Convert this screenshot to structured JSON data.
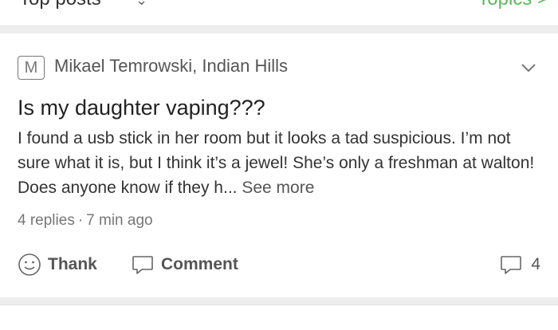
{
  "top_bar": {
    "left_label": "Top posts",
    "right_label": "Topics >"
  },
  "post": {
    "avatar_letter": "M",
    "author": "Mikael Temrowski, Indian Hills",
    "title": "Is my daughter vaping???",
    "body": "I found a usb stick in her room but it looks a tad suspicious. I’m not sure what it is, but I think it’s a jewel! She’s only a freshman at walton! Does anyone know if they h...",
    "see_more": "See more",
    "replies": "4 replies",
    "separator": "·",
    "time": "7 min ago",
    "thank_label": "Thank",
    "comment_label": "Comment",
    "comment_count": "4"
  },
  "next_post_partial": "..."
}
